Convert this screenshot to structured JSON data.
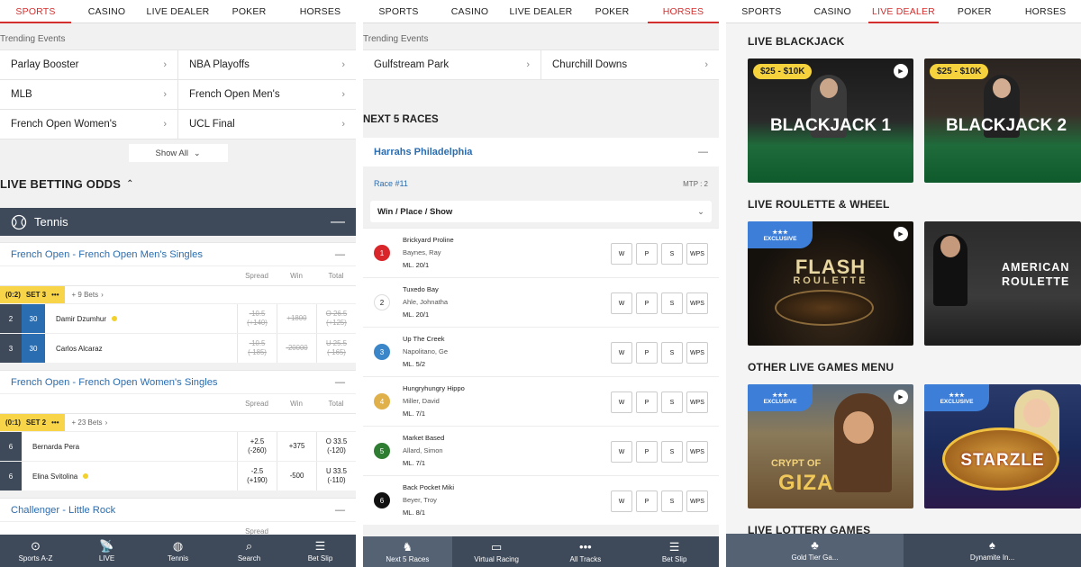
{
  "panel1": {
    "tabs": [
      "SPORTS",
      "CASINO",
      "LIVE DEALER",
      "POKER",
      "HORSES"
    ],
    "active_tab": 0,
    "trending_title": "Trending Events",
    "trending": [
      "Parlay Booster",
      "NBA Playoffs",
      "MLB",
      "French Open Men's",
      "French Open Women's",
      "UCL Final"
    ],
    "show_all": "Show All",
    "live_odds_title": "LIVE BETTING ODDS",
    "sport": "Tennis",
    "competitions": [
      {
        "name": "French Open - French Open Men's Singles",
        "col_spread": "Spread",
        "col_win": "Win",
        "col_total": "Total",
        "score": "(0:2)",
        "set": "SET 3",
        "bets": "+ 9 Bets",
        "rows": [
          {
            "a": "2",
            "b": "30",
            "name": "Damir Dzumhur",
            "serve": true,
            "spread": "-10.5",
            "spread2": "(+140)",
            "win": "+1800",
            "total": "O 26.5",
            "total2": "(+125)",
            "suspended": true
          },
          {
            "a": "3",
            "b": "30",
            "name": "Carlos Alcaraz",
            "serve": false,
            "spread": "-10.5",
            "spread2": "(-185)",
            "win": "-20000",
            "total": "U 25.5",
            "total2": "(-165)",
            "suspended": true
          }
        ]
      },
      {
        "name": "French Open - French Open Women's Singles",
        "col_spread": "Spread",
        "col_win": "Win",
        "col_total": "Total",
        "score": "(0:1)",
        "set": "SET 2",
        "bets": "+ 23 Bets",
        "rows": [
          {
            "a": "6",
            "b": "",
            "name": "Bernarda Pera",
            "serve": false,
            "spread": "+2.5",
            "spread2": "(-260)",
            "win": "+375",
            "total": "O 33.5",
            "total2": "(-120)",
            "suspended": false
          },
          {
            "a": "6",
            "b": "",
            "name": "Elina Svitolina",
            "serve": true,
            "spread": "-2.5",
            "spread2": "(+190)",
            "win": "-500",
            "total": "U 33.5",
            "total2": "(-110)",
            "suspended": false
          }
        ]
      }
    ],
    "next_comp": "Challenger - Little Rock",
    "next_col_spread": "Spread",
    "bottom_nav": [
      "Sports A-Z",
      "LIVE",
      "Tennis",
      "Search",
      "Bet Slip"
    ]
  },
  "panel2": {
    "tabs": [
      "SPORTS",
      "CASINO",
      "LIVE DEALER",
      "POKER",
      "HORSES"
    ],
    "active_tab": 4,
    "trending_title": "Trending Events",
    "trending": [
      "Gulfstream Park",
      "Churchill Downs"
    ],
    "next_races_title": "NEXT 5 RACES",
    "track": "Harrahs Philadelphia",
    "race": "Race #11",
    "mtp": "MTP : 2",
    "wps_label": "Win / Place / Show",
    "buttons": [
      "W",
      "P",
      "S",
      "WPS"
    ],
    "runners": [
      {
        "num": "1",
        "name": "Brickyard Proline",
        "jockey": "Baynes, Ray",
        "ml": "ML. 20/1",
        "color": "#d9262b",
        "fg": "#fff"
      },
      {
        "num": "2",
        "name": "Tuxedo Bay",
        "jockey": "Ahle, Johnatha",
        "ml": "ML. 20/1",
        "color": "#ffffff",
        "fg": "#222"
      },
      {
        "num": "3",
        "name": "Up The Creek",
        "jockey": "Napolitano, Ge",
        "ml": "ML. 5/2",
        "color": "#3a86c8",
        "fg": "#fff"
      },
      {
        "num": "4",
        "name": "Hungryhungry Hippo",
        "jockey": "Miller, David",
        "ml": "ML. 7/1",
        "color": "#e0b04a",
        "fg": "#fff"
      },
      {
        "num": "5",
        "name": "Market Based",
        "jockey": "Allard, Simon",
        "ml": "ML. 7/1",
        "color": "#2e7d32",
        "fg": "#fff"
      },
      {
        "num": "6",
        "name": "Back Pocket Miki",
        "jockey": "Beyer, Troy",
        "ml": "ML. 8/1",
        "color": "#111111",
        "fg": "#fff"
      }
    ],
    "bottom_nav": [
      "Next 5 Races",
      "Virtual Racing",
      "All Tracks",
      "Bet Slip"
    ]
  },
  "panel3": {
    "tabs": [
      "SPORTS",
      "CASINO",
      "LIVE DEALER",
      "POKER",
      "HORSES"
    ],
    "active_tab": 2,
    "sections": [
      "LIVE BLACKJACK",
      "LIVE ROULETTE & WHEEL",
      "OTHER LIVE GAMES MENU",
      "LIVE LOTTERY GAMES"
    ],
    "blackjack": [
      {
        "badge": "$25 - $10K",
        "title": "BLACKJACK 1"
      },
      {
        "badge": "$25 - $10K",
        "title": "BLACKJACK 2"
      }
    ],
    "roulette": [
      {
        "exclusive": "EXCLUSIVE",
        "title": "FLASH",
        "sub": "ROULETTE"
      },
      {
        "exclusive": "",
        "title": "AMERICAN",
        "sub": "ROULETTE"
      }
    ],
    "other": [
      {
        "exclusive": "EXCLUSIVE",
        "title": "CRYPT OF",
        "sub": "GIZA"
      },
      {
        "exclusive": "EXCLUSIVE",
        "title": "STARZLE",
        "sub": ""
      }
    ],
    "bottom_nav": [
      "Gold Tier Ga...",
      "Dynamite In..."
    ]
  }
}
